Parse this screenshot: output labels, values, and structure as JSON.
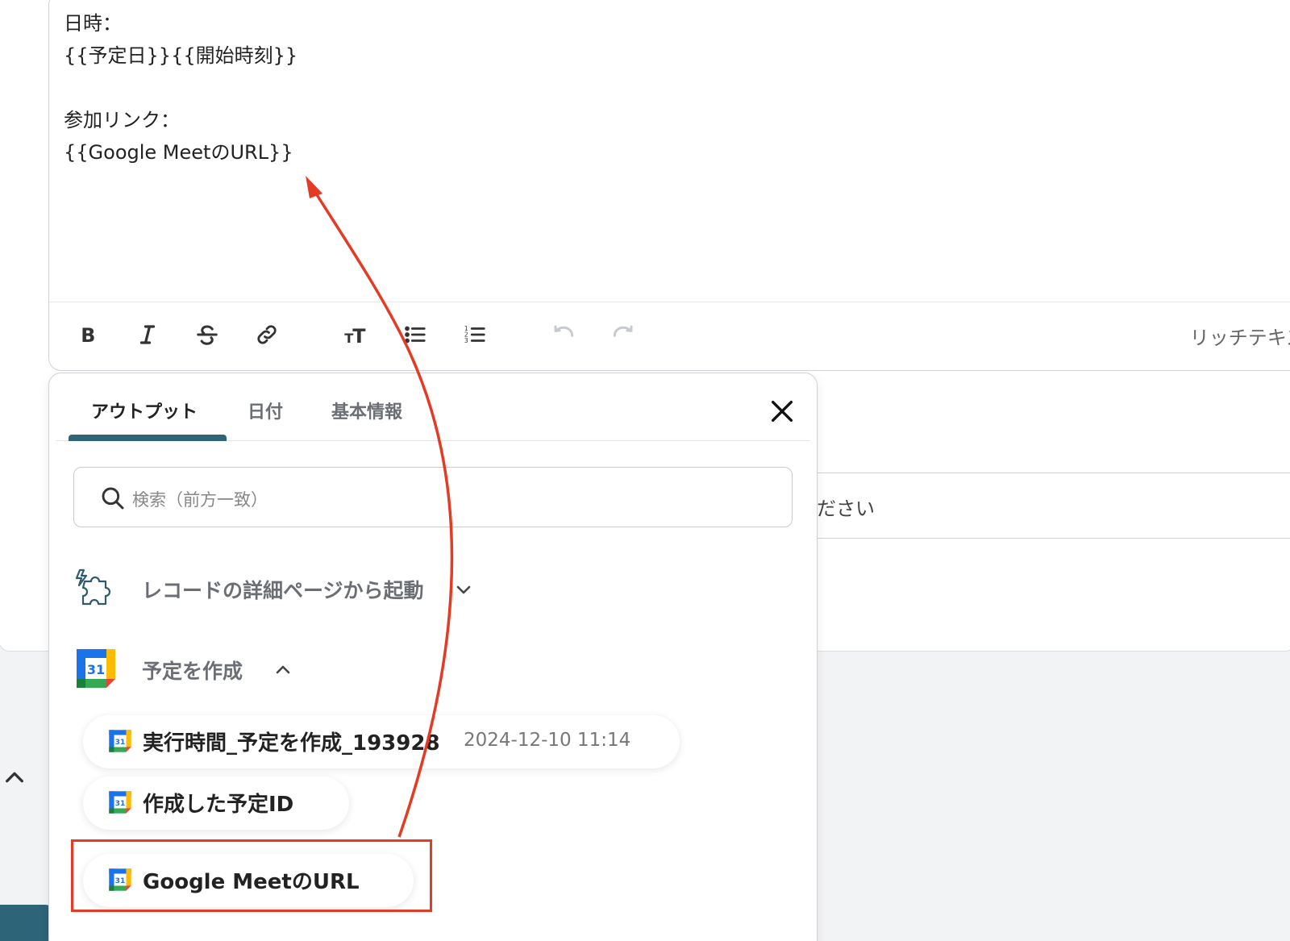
{
  "editor": {
    "lines": [
      "日時：",
      "{{予定日}}{{開始時刻}}",
      "",
      "参加リンク：",
      "{{Google MeetのURL}}"
    ],
    "toolbar": {
      "bold_icon": "bold-icon",
      "italic_icon": "italic-icon",
      "strike_icon": "strikethrough-icon",
      "link_icon": "link-icon",
      "textsize_icon": "text-size-icon",
      "bullet_icon": "bulleted-list-icon",
      "numbered_icon": "numbered-list-icon",
      "undo_icon": "undo-icon",
      "redo_icon": "redo-icon",
      "rich_text_label": "リッチテキス"
    }
  },
  "background": {
    "input_text": "ださい"
  },
  "popup": {
    "tabs": [
      {
        "label": "アウトプット",
        "active": true
      },
      {
        "label": "日付",
        "active": false
      },
      {
        "label": "基本情報",
        "active": false
      }
    ],
    "search_placeholder": "検索（前方一致）",
    "groups": [
      {
        "label": "レコードの詳細ページから起動",
        "icon": "puzzle-icon",
        "expanded": false
      },
      {
        "label": "予定を作成",
        "icon": "google-calendar-icon",
        "expanded": true
      }
    ],
    "items": [
      {
        "label": "実行時間_予定を作成_193928",
        "value": "2024-12-10 11:14"
      },
      {
        "label": "作成した予定ID",
        "value": ""
      },
      {
        "label": "Google MeetのURL",
        "value": "",
        "highlighted": true
      }
    ]
  },
  "colors": {
    "accent": "#2d6478",
    "annotation_red": "#e33b24"
  }
}
